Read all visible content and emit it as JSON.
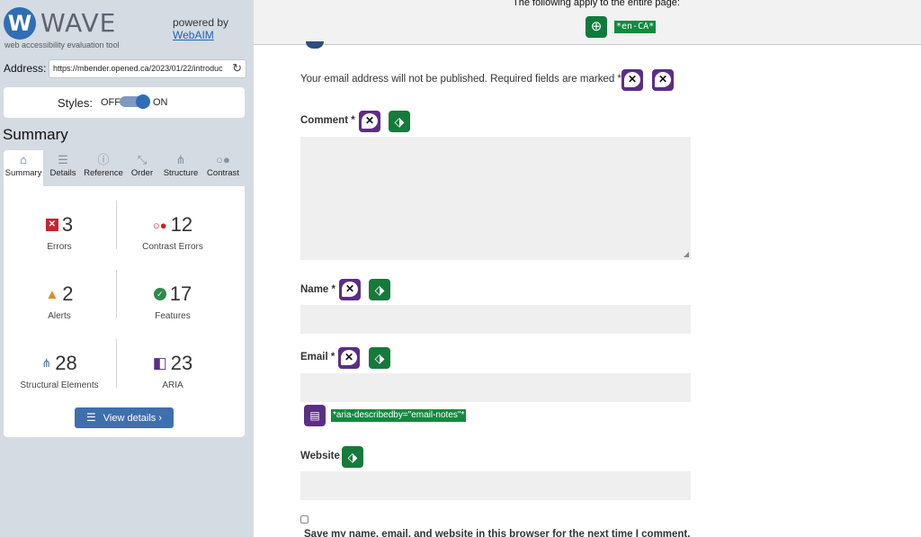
{
  "sidebar": {
    "logo_letter": "W",
    "logo_word": "WAVE",
    "tagline": "web accessibility evaluation tool",
    "powered_by": "powered by",
    "powered_link": "WebAIM",
    "address_label": "Address:",
    "address_value": "https://mbender.opened.ca/2023/01/22/introduc",
    "reload_icon": "reload-icon",
    "styles_label": "Styles:",
    "styles_off": "OFF",
    "styles_on": "ON",
    "styles_state": "on",
    "summary_title": "Summary",
    "tabs": [
      {
        "label": "Summary",
        "icon": "home-icon",
        "glyph": "⌂",
        "active": true
      },
      {
        "label": "Details",
        "icon": "list-icon",
        "glyph": "☰",
        "active": false
      },
      {
        "label": "Reference",
        "icon": "info-icon",
        "glyph": "ⓘ",
        "active": false
      },
      {
        "label": "Order",
        "icon": "order-icon",
        "glyph": "⤡",
        "active": false
      },
      {
        "label": "Structure",
        "icon": "structure-icon",
        "glyph": "⋔",
        "active": false
      },
      {
        "label": "Contrast",
        "icon": "contrast-icon",
        "glyph": "○●",
        "active": false
      }
    ],
    "stats": [
      {
        "value": "3",
        "label": "Errors",
        "icon": "error-icon",
        "glyph": "✕",
        "color": "#c8242b"
      },
      {
        "value": "12",
        "label": "Contrast Errors",
        "icon": "contrast-error-icon",
        "glyph": "○●",
        "color": "#c8242b"
      },
      {
        "value": "2",
        "label": "Alerts",
        "icon": "alert-icon",
        "glyph": "!",
        "color": "#e38a1c"
      },
      {
        "value": "17",
        "label": "Features",
        "icon": "feature-icon",
        "glyph": "✓",
        "color": "#2e8a4a"
      },
      {
        "value": "28",
        "label": "Structural Elements",
        "icon": "structure-icon",
        "glyph": "⋔",
        "color": "#3f6fae"
      },
      {
        "value": "23",
        "label": "ARIA",
        "icon": "aria-icon",
        "glyph": "◧",
        "color": "#5b2e86"
      }
    ],
    "view_details": "View details ›"
  },
  "main": {
    "banner_text": "The following apply to the entire page:",
    "globe_icon": "globe-icon",
    "lang_tag": "*en-CA*",
    "notes": "Your email address will not be published. Required fields are marked *",
    "fields": {
      "comment_label": "Comment *",
      "name_label": "Name *",
      "email_label": "Email *",
      "website_label": "Website"
    },
    "aria_describedby": "*aria-describedby=\"email-notes\"*",
    "save_text": "Save my name, email, and website in this browser for the next time I comment."
  },
  "colors": {
    "error_purple": "#5b2e86",
    "label_green": "#167a3c",
    "wave_blue": "#2f6eb5",
    "sidebar_bg": "#d5dbe3"
  }
}
